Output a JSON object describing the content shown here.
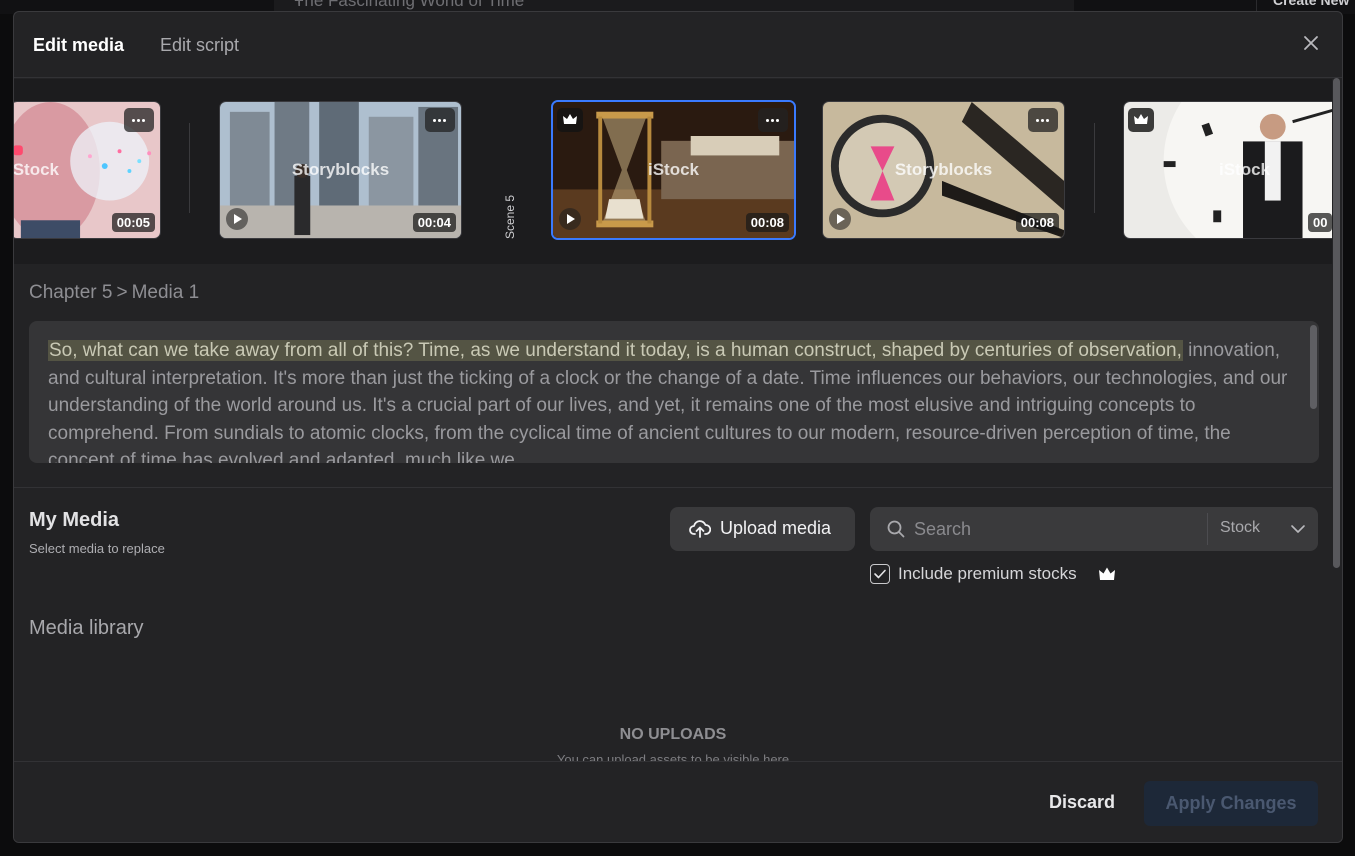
{
  "background": {
    "project_title": "The Fascinating World of Time",
    "create_new_label": "Create New"
  },
  "header": {
    "tabs": [
      {
        "label": "Edit media",
        "active": true
      },
      {
        "label": "Edit script",
        "active": false
      }
    ]
  },
  "strip": {
    "scene_label": "Scene 5",
    "thumbnails": [
      {
        "source": "iStock",
        "duration": "00:05",
        "premium": false,
        "selected": false
      },
      {
        "source": "Storyblocks",
        "duration": "00:04",
        "premium": false,
        "selected": false
      },
      {
        "source": "iStock",
        "duration": "00:08",
        "premium": true,
        "selected": true
      },
      {
        "source": "Storyblocks",
        "duration": "00:08",
        "premium": false,
        "selected": false
      },
      {
        "source": "iStock",
        "duration": "00",
        "premium": true,
        "selected": false
      }
    ]
  },
  "breadcrumb": {
    "chapter": "Chapter 5",
    "separator": ">",
    "media": "Media 1"
  },
  "script": {
    "highlighted": "So, what can we take away from all of this? Time, as we understand it today, is a human construct, shaped by centuries of observation,",
    "rest": " innovation, and cultural interpretation. It's more than just the ticking of a clock or the change of a date. Time influences our behaviors, our technologies, and our understanding of the world around us. It's a crucial part of our lives, and yet, it remains one of the most elusive and intriguing concepts to comprehend. From sundials to atomic clocks, from the cyclical time of ancient cultures to our modern, resource-driven perception of time, the concept of time has evolved and adapted, much like we"
  },
  "my_media": {
    "title": "My Media",
    "subtitle": "Select media to replace",
    "upload_label": "Upload media",
    "search_placeholder": "Search",
    "source_select": "Stock",
    "include_premium_label": "Include premium stocks",
    "include_premium_checked": true
  },
  "library": {
    "title": "Media library",
    "empty_title": "NO UPLOADS",
    "empty_subtitle": "You can upload assets to be visible here"
  },
  "footer": {
    "discard_label": "Discard",
    "apply_label": "Apply Changes"
  },
  "colors": {
    "accent": "#3a7afe",
    "highlight": "#545444",
    "modal_bg": "#232325"
  }
}
